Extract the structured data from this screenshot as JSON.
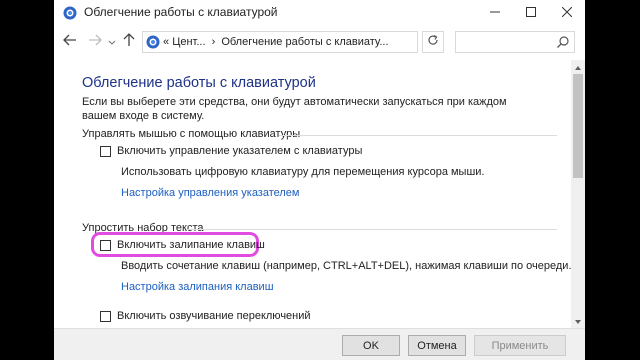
{
  "window": {
    "title": "Облегчение работы с клавиатурой"
  },
  "address_bar": {
    "history_label": "«",
    "crumb_root": "Цент...",
    "separator": "›",
    "crumb_current": "Облегчение работы с клавиату...",
    "search_placeholder": ""
  },
  "main": {
    "title": "Облегчение работы с клавиатурой",
    "intro": "Если вы выберете эти средства, они будут автоматически запускаться при каждом вашем входе в систему.",
    "sections": [
      {
        "header": "Управлять мышью с помощью клавиатуры",
        "option_label": "Включить управление указателем с клавиатуры",
        "checked": false,
        "description": "Использовать цифровую клавиатуру для перемещения курсора мыши.",
        "link": "Настройка управления указателем"
      },
      {
        "header": "Упростить набор текста",
        "option_label": "Включить залипание клавиш",
        "checked": false,
        "description": "Вводить сочетание клавиш (например, CTRL+ALT+DEL), нажимая клавиши по очереди.",
        "link": "Настройка залипания клавиш"
      }
    ],
    "toggle_keys_label": "Включить озвучивание переключений"
  },
  "footer": {
    "ok_label": "OK",
    "cancel_label": "Отмена",
    "apply_label": "Применить"
  },
  "colors": {
    "title_blue": "#1e3287",
    "link_blue": "#1c5fbf",
    "highlight": "#e04ce0"
  },
  "icons": {
    "app": "control-panel-icon",
    "minimize": "minimize-icon",
    "maximize": "maximize-icon",
    "close": "close-icon",
    "back": "arrow-left-icon",
    "forward": "arrow-right-icon",
    "up": "arrow-up-icon",
    "refresh": "refresh-icon",
    "search": "search-icon"
  }
}
